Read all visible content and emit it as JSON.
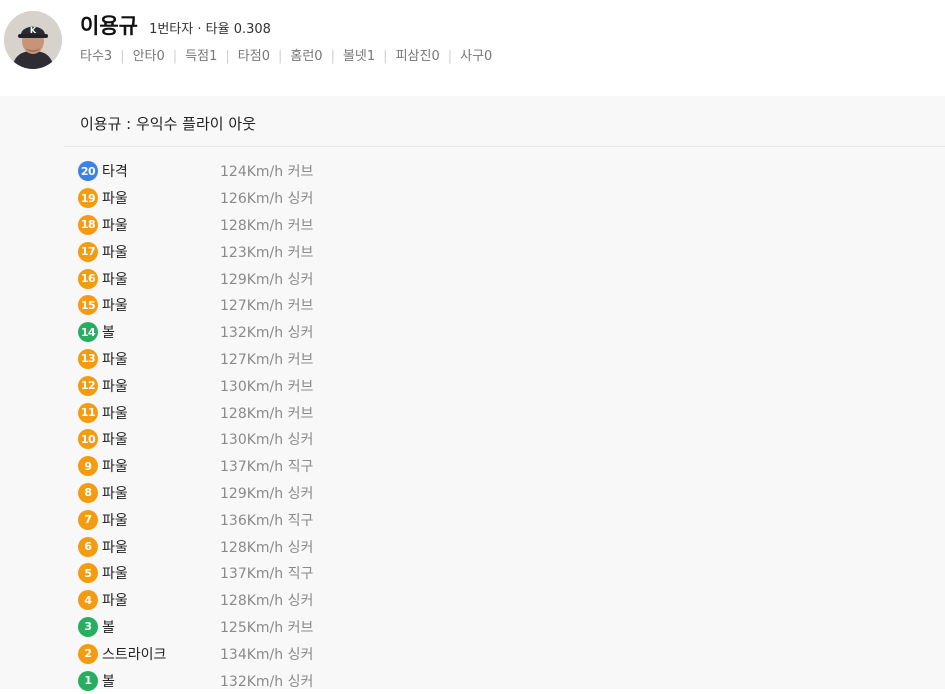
{
  "player": {
    "name": "이용규",
    "order": "1번타자",
    "avg_label": "타율",
    "avg": "0.308",
    "stats": [
      {
        "label": "타수",
        "value": "3"
      },
      {
        "label": "안타",
        "value": "0"
      },
      {
        "label": "득점",
        "value": "1"
      },
      {
        "label": "타점",
        "value": "0"
      },
      {
        "label": "홈런",
        "value": "0"
      },
      {
        "label": "볼넷",
        "value": "1"
      },
      {
        "label": "피삼진",
        "value": "0"
      },
      {
        "label": "사구",
        "value": "0"
      }
    ]
  },
  "at_bat_result": "이용규 : 우익수 플라이 아웃",
  "pitches": [
    {
      "num": "20",
      "result": "타격",
      "speed": "124Km/h",
      "type": "커브",
      "color": "#3b82e6"
    },
    {
      "num": "19",
      "result": "파울",
      "speed": "126Km/h",
      "type": "싱커",
      "color": "#f39c12"
    },
    {
      "num": "18",
      "result": "파울",
      "speed": "128Km/h",
      "type": "커브",
      "color": "#f39c12"
    },
    {
      "num": "17",
      "result": "파울",
      "speed": "123Km/h",
      "type": "커브",
      "color": "#f39c12"
    },
    {
      "num": "16",
      "result": "파울",
      "speed": "129Km/h",
      "type": "싱커",
      "color": "#f39c12"
    },
    {
      "num": "15",
      "result": "파울",
      "speed": "127Km/h",
      "type": "커브",
      "color": "#f39c12"
    },
    {
      "num": "14",
      "result": "볼",
      "speed": "132Km/h",
      "type": "싱커",
      "color": "#27ae60"
    },
    {
      "num": "13",
      "result": "파울",
      "speed": "127Km/h",
      "type": "커브",
      "color": "#f39c12"
    },
    {
      "num": "12",
      "result": "파울",
      "speed": "130Km/h",
      "type": "커브",
      "color": "#f39c12"
    },
    {
      "num": "11",
      "result": "파울",
      "speed": "128Km/h",
      "type": "커브",
      "color": "#f39c12"
    },
    {
      "num": "10",
      "result": "파울",
      "speed": "130Km/h",
      "type": "싱커",
      "color": "#f39c12"
    },
    {
      "num": "9",
      "result": "파울",
      "speed": "137Km/h",
      "type": "직구",
      "color": "#f39c12"
    },
    {
      "num": "8",
      "result": "파울",
      "speed": "129Km/h",
      "type": "싱커",
      "color": "#f39c12"
    },
    {
      "num": "7",
      "result": "파울",
      "speed": "136Km/h",
      "type": "직구",
      "color": "#f39c12"
    },
    {
      "num": "6",
      "result": "파울",
      "speed": "128Km/h",
      "type": "싱커",
      "color": "#f39c12"
    },
    {
      "num": "5",
      "result": "파울",
      "speed": "137Km/h",
      "type": "직구",
      "color": "#f39c12"
    },
    {
      "num": "4",
      "result": "파울",
      "speed": "128Km/h",
      "type": "싱커",
      "color": "#f39c12"
    },
    {
      "num": "3",
      "result": "볼",
      "speed": "125Km/h",
      "type": "커브",
      "color": "#27ae60"
    },
    {
      "num": "2",
      "result": "스트라이크",
      "speed": "134Km/h",
      "type": "싱커",
      "color": "#f39c12"
    },
    {
      "num": "1",
      "result": "볼",
      "speed": "132Km/h",
      "type": "싱커",
      "color": "#27ae60"
    }
  ]
}
